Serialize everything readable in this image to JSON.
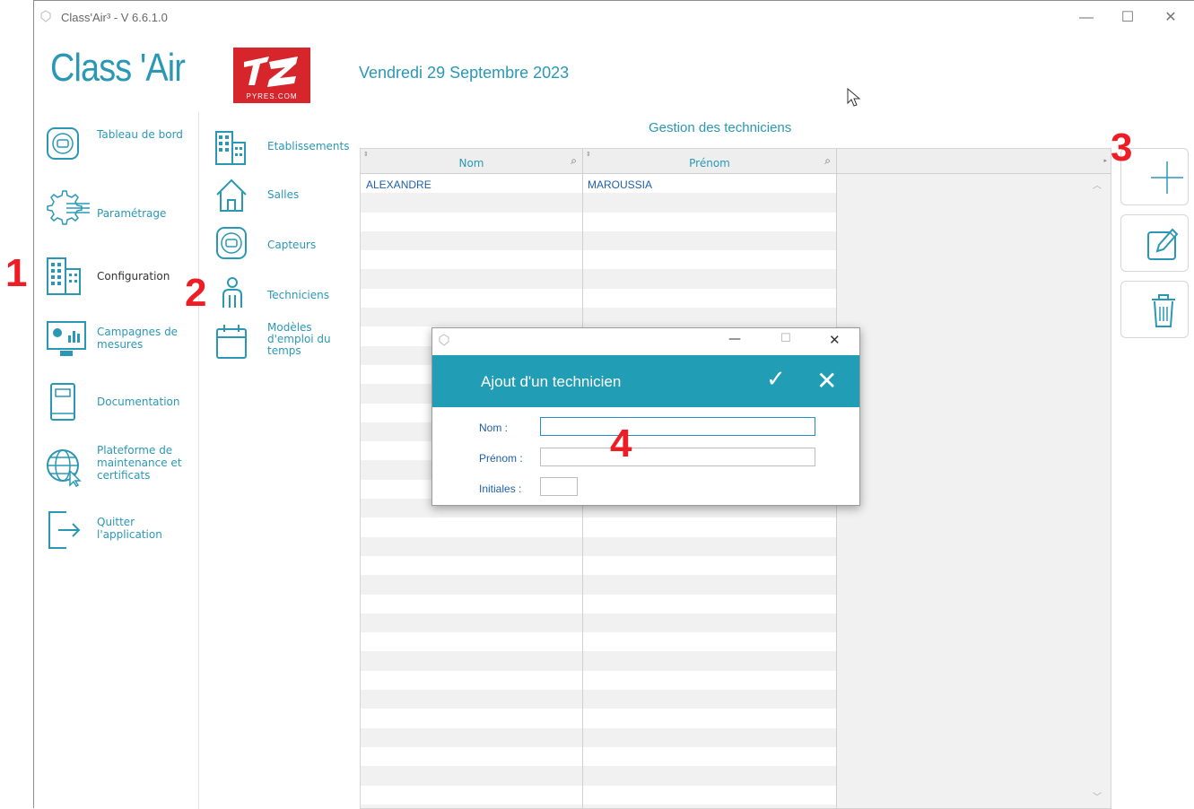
{
  "window": {
    "title": "Class'Air³ - V 6.6.1.0",
    "minimize": "—",
    "maximize": "☐",
    "close": "✕"
  },
  "header": {
    "logo_text": "Class 'Air",
    "brand_sub": "PYRES.COM",
    "date": "Vendredi 29 Septembre 2023"
  },
  "nav_main": [
    {
      "label": "Tableau de bord",
      "icon": "sensor-icon"
    },
    {
      "label": "Paramétrage",
      "icon": "gear-icon"
    },
    {
      "label": "Configuration",
      "icon": "building-icon"
    },
    {
      "label": "Campagnes de mesures",
      "icon": "monitor-chart-icon"
    },
    {
      "label": "Documentation",
      "icon": "book-icon"
    },
    {
      "label": "Plateforme de maintenance et certificats",
      "icon": "globe-cursor-icon"
    },
    {
      "label": "Quitter l'application",
      "icon": "exit-icon"
    }
  ],
  "nav_sub": [
    {
      "label": "Etablissements",
      "icon": "building-icon"
    },
    {
      "label": "Salles",
      "icon": "house-icon"
    },
    {
      "label": "Capteurs",
      "icon": "sensor-icon"
    },
    {
      "label": "Techniciens",
      "icon": "person-icon"
    },
    {
      "label": "Modèles d'emploi du temps",
      "icon": "calendar-icon"
    }
  ],
  "grid": {
    "title": "Gestion des techniciens",
    "columns": [
      "Nom",
      "Prénom"
    ],
    "rows": [
      {
        "nom": "ALEXANDRE",
        "prenom": "MAROUSSIA"
      }
    ]
  },
  "actions": {
    "add": "plus-icon",
    "edit": "edit-icon",
    "delete": "trash-icon"
  },
  "annotations": {
    "a1": "1",
    "a2": "2",
    "a3": "3",
    "a4": "4"
  },
  "dialog": {
    "title": "Ajout d'un technicien",
    "minimize": "—",
    "maximize": "☐",
    "close": "✕",
    "ok": "✓",
    "cancel": "✕",
    "fields": {
      "nom_label": "Nom :",
      "nom_value": "",
      "prenom_label": "Prénom :",
      "prenom_value": "",
      "initiales_label": "Initiales :",
      "initiales_value": ""
    }
  },
  "colors": {
    "accent": "#2a98b5",
    "dialog_header": "#219db5",
    "brand": "#d6262b",
    "annotation": "#ee1c25"
  }
}
